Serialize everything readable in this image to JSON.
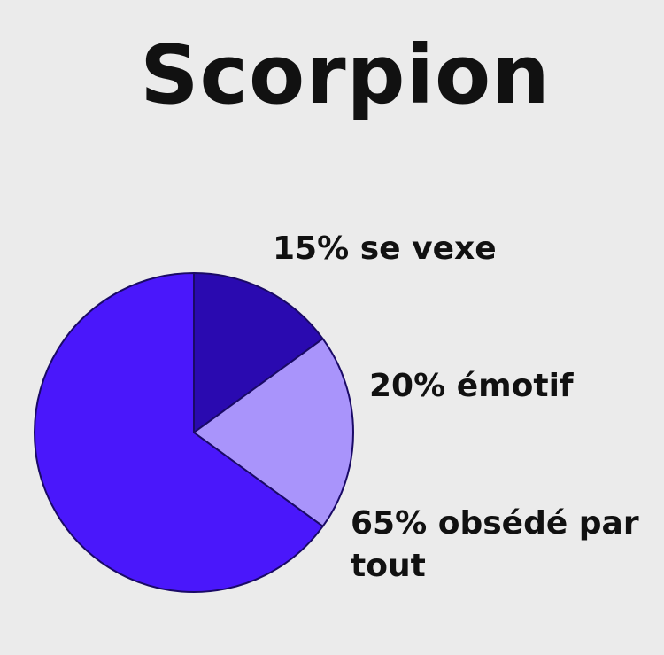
{
  "chart_data": {
    "type": "pie",
    "title": "Scorpion",
    "slices": [
      {
        "label": "se vexe",
        "percent_label": "15%",
        "value": 15,
        "color": "#2a0ab0"
      },
      {
        "label": "émotif",
        "percent_label": "20%",
        "value": 20,
        "color": "#a994fb"
      },
      {
        "label": "obsédé par tout",
        "percent_label": "65%",
        "value": 65,
        "color": "#4a17fb"
      }
    ],
    "legend": "none",
    "grid": false
  }
}
